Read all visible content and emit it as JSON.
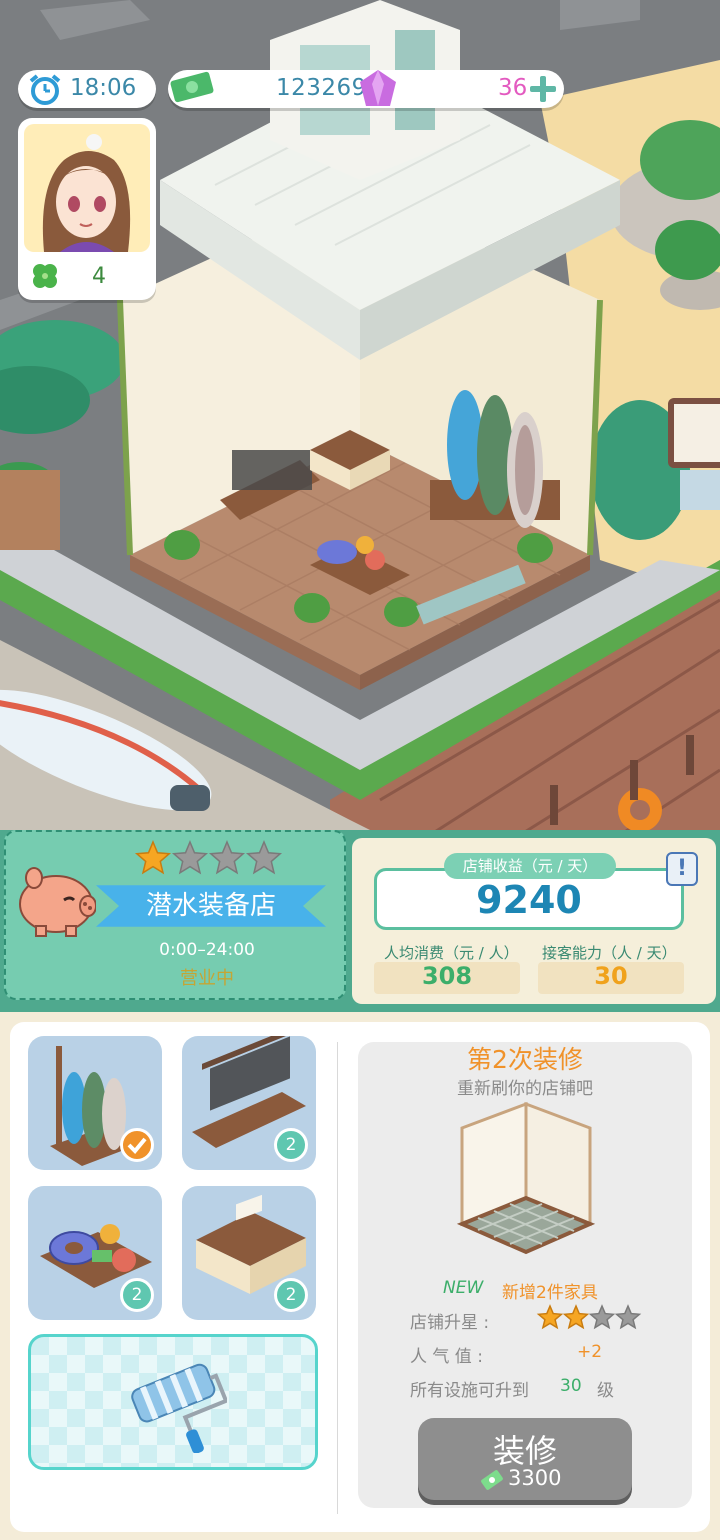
{
  "hud": {
    "time": "18:06",
    "cash": "123269",
    "gems": "36",
    "clover_count": "4"
  },
  "shop": {
    "name": "潜水装备店",
    "stars_filled": 1,
    "stars_total": 4,
    "hours": "0:00–24:00",
    "status": "营业中"
  },
  "stats": {
    "revenue_label": "店铺收益（元 / 天）",
    "revenue_value": "9240",
    "avg_spend_label": "人均消费（元 / 人）",
    "avg_spend_value": "308",
    "capacity_label": "接客能力（人 / 天）",
    "capacity_value": "30",
    "info_symbol": "!"
  },
  "furniture": [
    {
      "name": "surfboard-rack",
      "badge": "check"
    },
    {
      "name": "diving-suit-rack",
      "badge": "2"
    },
    {
      "name": "swim-ring-table",
      "badge": "2"
    },
    {
      "name": "counter",
      "badge": "2"
    }
  ],
  "renovation": {
    "title": "第2次装修",
    "subtitle": "重新刷你的店铺吧",
    "new_tag": "NEW",
    "new_text": "新增2件家具",
    "star_label": "店铺升星 :",
    "star_filled": 2,
    "star_total": 4,
    "popularity_label": "人  气  值 :",
    "popularity_value": "+2",
    "facility_prefix": "所有设施可升到",
    "facility_level": "30",
    "facility_suffix": "级",
    "button_label": "装修",
    "button_cost": "3300"
  },
  "colors": {
    "accent_orange": "#f0922a",
    "teal": "#4fa98e",
    "blue_value": "#1d86b4",
    "green_value": "#3cae6a",
    "orange_value": "#f0a21c",
    "star_gold": "#f6a623",
    "star_gray": "#9a9a9a",
    "gem_pink": "#e35ac0"
  }
}
